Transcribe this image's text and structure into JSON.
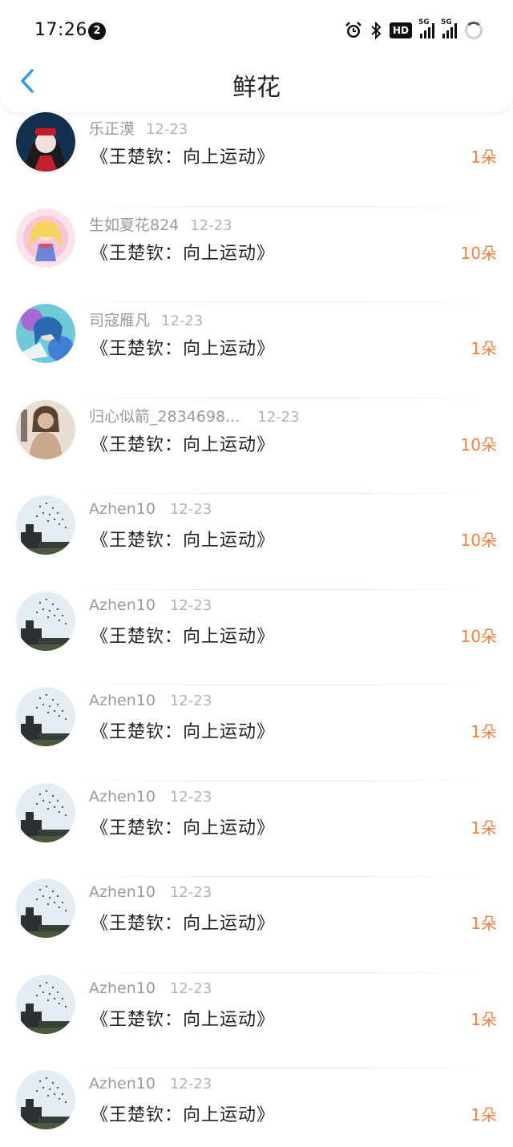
{
  "status_bar": {
    "time": "17:26",
    "notification_count": "2",
    "hd_label": "HD",
    "net_label": "5G",
    "net_label_2": "5G"
  },
  "header": {
    "title": "鲜花"
  },
  "colors": {
    "accent_blue": "#2f9be8",
    "count_orange": "#f0803c"
  },
  "rows": [
    {
      "name": "乐正漠",
      "date": "12-23",
      "book": "《王楚钦：向上运动》",
      "count": "1朵",
      "avatar": "anime-girl-red-bow"
    },
    {
      "name": "生如夏花824",
      "date": "12-23",
      "book": "《王楚钦：向上运动》",
      "count": "10朵",
      "avatar": "pink-cartoon"
    },
    {
      "name": "司寇雁凡",
      "date": "12-23",
      "book": "《王楚钦：向上运动》",
      "count": "1朵",
      "avatar": "colorful-illustration"
    },
    {
      "name": "归心似箭_2834698...",
      "date": "12-23",
      "book": "《王楚钦：向上运动》",
      "count": "10朵",
      "avatar": "photo-person"
    },
    {
      "name": "Azhen10",
      "date": "12-23",
      "book": "《王楚钦：向上运动》",
      "count": "10朵",
      "avatar": "building-birds"
    },
    {
      "name": "Azhen10",
      "date": "12-23",
      "book": "《王楚钦：向上运动》",
      "count": "10朵",
      "avatar": "building-birds"
    },
    {
      "name": "Azhen10",
      "date": "12-23",
      "book": "《王楚钦：向上运动》",
      "count": "1朵",
      "avatar": "building-birds"
    },
    {
      "name": "Azhen10",
      "date": "12-23",
      "book": "《王楚钦：向上运动》",
      "count": "1朵",
      "avatar": "building-birds"
    },
    {
      "name": "Azhen10",
      "date": "12-23",
      "book": "《王楚钦：向上运动》",
      "count": "1朵",
      "avatar": "building-birds"
    },
    {
      "name": "Azhen10",
      "date": "12-23",
      "book": "《王楚钦：向上运动》",
      "count": "1朵",
      "avatar": "building-birds"
    },
    {
      "name": "Azhen10",
      "date": "12-23",
      "book": "《王楚钦：向上运动》",
      "count": "1朵",
      "avatar": "building-birds"
    }
  ]
}
